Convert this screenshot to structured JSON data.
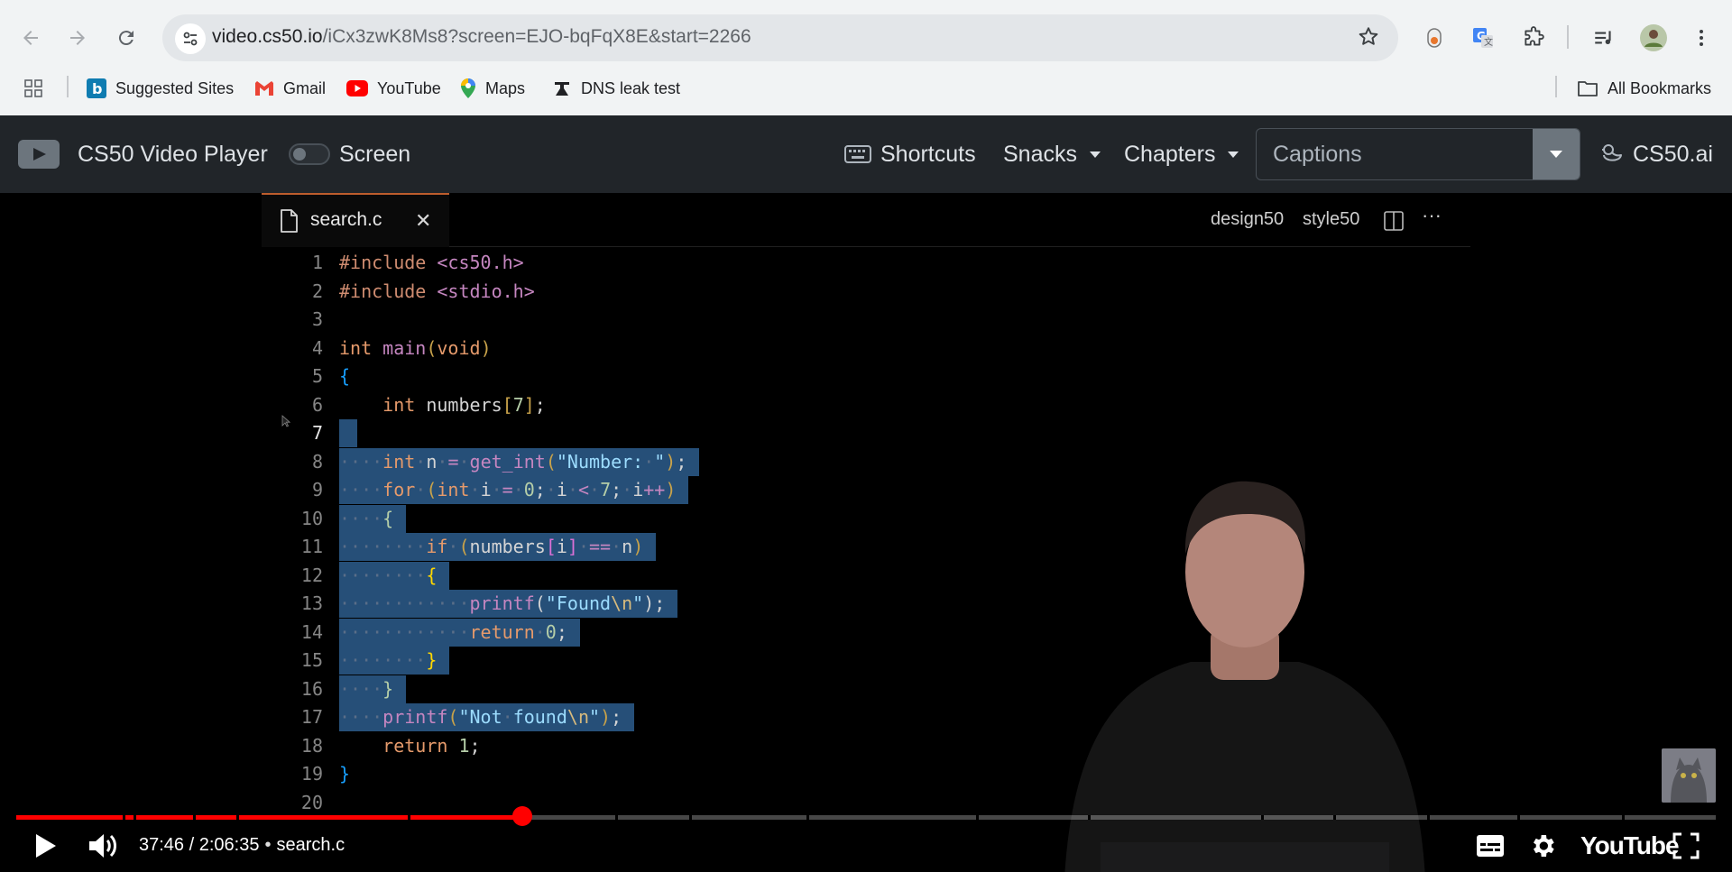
{
  "browser": {
    "url_host": "video.cs50.io",
    "url_path": "/iCx3zwK8Ms8?screen=EJO-bqFqX8E&start=2266",
    "bookmarks": [
      {
        "label": "Suggested Sites",
        "icon": "bing-icon"
      },
      {
        "label": "Gmail",
        "icon": "gmail-icon"
      },
      {
        "label": "YouTube",
        "icon": "youtube-icon"
      },
      {
        "label": "Maps",
        "icon": "maps-icon"
      },
      {
        "label": "DNS leak test",
        "icon": "dns-icon"
      }
    ],
    "all_bookmarks": "All Bookmarks"
  },
  "player_bar": {
    "title": "CS50 Video Player",
    "screen_label": "Screen",
    "shortcuts": "Shortcuts",
    "snacks": "Snacks",
    "chapters": "Chapters",
    "captions": "Captions",
    "ai": "CS50.ai"
  },
  "editor": {
    "tab_name": "search.c",
    "design50": "design50",
    "style50": "style50",
    "line_numbers": [
      "1",
      "2",
      "3",
      "4",
      "5",
      "6",
      "7",
      "8",
      "9",
      "10",
      "11",
      "12",
      "13",
      "14",
      "15",
      "16",
      "17",
      "18",
      "19",
      "20"
    ],
    "selected_lines": [
      7,
      17
    ],
    "current_line": 7
  },
  "youtube": {
    "time_current": "37:46",
    "time_total": "2:06:35",
    "chapter": "search.c",
    "progress": 0.298,
    "brand": "YouTube"
  },
  "colors": {
    "accent_red": "#ff0000",
    "player_bar_bg": "#212529",
    "selection": "#264f78"
  }
}
